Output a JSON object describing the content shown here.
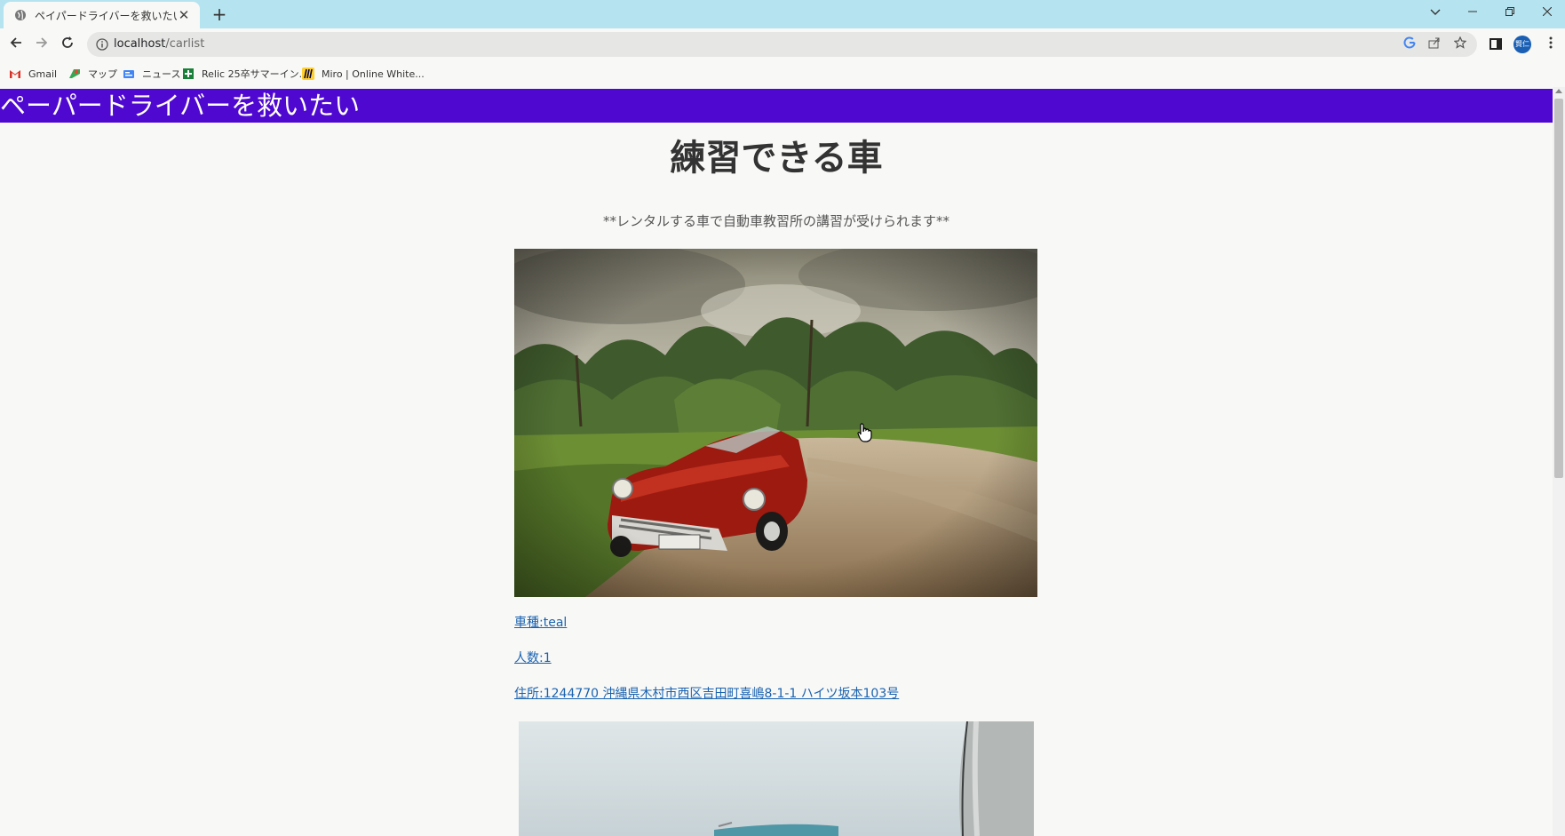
{
  "browser": {
    "tab_title": "ペイパードライバーを救いたい",
    "tab_close": "✕",
    "new_tab": "+",
    "url_host": "localhost",
    "url_path": "/carlist",
    "bookmarks": [
      {
        "label": "Gmail",
        "icon": "gmail-icon",
        "color": "#d93025"
      },
      {
        "label": "マップ",
        "icon": "maps-icon",
        "color": "#34a853"
      },
      {
        "label": "ニュース",
        "icon": "news-icon",
        "color": "#4285f4"
      },
      {
        "label": "Relic 25卒サマーイン...",
        "icon": "sheets-icon",
        "color": "#188038"
      },
      {
        "label": "Miro | Online White...",
        "icon": "miro-icon",
        "color": "#ffd02f"
      }
    ],
    "profile_initials": "賢仁",
    "tabbar_color": "#b5e3ef"
  },
  "site": {
    "header_title": "ペーパードライバーを救いたい",
    "header_color": "#4f08d0"
  },
  "main": {
    "heading": "練習できる車",
    "subtitle": "**レンタルする車で自動車教習所の講習が受けられます**",
    "cars": [
      {
        "type_label": "車種:teal",
        "capacity_label": "人数:1",
        "address_label": "住所:1244770 沖縄県木村市西区吉田町喜嶋8-1-1 ハイツ坂本103号"
      }
    ]
  },
  "colors": {
    "link": "#1a62b0",
    "page_bg": "#f8f8f6"
  }
}
